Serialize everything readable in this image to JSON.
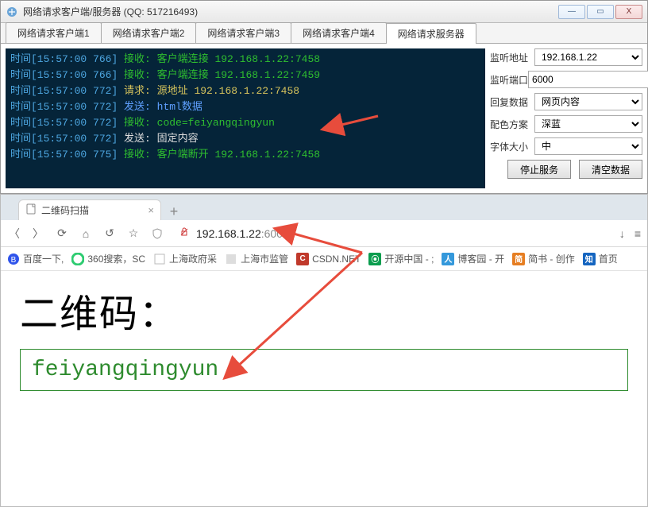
{
  "window": {
    "title": "网络请求客户端/服务器 (QQ: 517216493)",
    "winbtn": {
      "min": "—",
      "max": "▭",
      "close": "X"
    }
  },
  "tabs": [
    "网络请求客户端1",
    "网络请求客户端2",
    "网络请求客户端3",
    "网络请求客户端4",
    "网络请求服务器"
  ],
  "console": [
    {
      "t": "时间[15:57:00 766] ",
      "a": "接收: ",
      "ac": "green",
      "b": "客户端连接 192.168.1.22:7458",
      "bc": "green"
    },
    {
      "t": "时间[15:57:00 766] ",
      "a": "接收: ",
      "ac": "green",
      "b": "客户端连接 192.168.1.22:7459",
      "bc": "green"
    },
    {
      "t": "时间[15:57:00 772] ",
      "a": "请求: ",
      "ac": "yellow",
      "b": "源地址 192.168.1.22:7458",
      "bc": "yellow"
    },
    {
      "t": "时间[15:57:00 772] ",
      "a": "发送: ",
      "ac": "blue",
      "b": "html数据",
      "bc": "blue"
    },
    {
      "t": "时间[15:57:00 772] ",
      "a": "接收: ",
      "ac": "green",
      "b": "code=feiyangqingyun",
      "bc": "green"
    },
    {
      "t": "时间[15:57:00 772] ",
      "a": "发送: ",
      "ac": "white",
      "b": "固定内容",
      "bc": "white"
    },
    {
      "t": "时间[15:57:00 775] ",
      "a": "接收: ",
      "ac": "green",
      "b": "客户端断开 192.168.1.22:7458",
      "bc": "green"
    }
  ],
  "side": {
    "addr_label": "监听地址",
    "addr_value": "192.168.1.22",
    "port_label": "监听端口",
    "port_value": "6000",
    "reply_label": "回复数据",
    "reply_value": "网页内容",
    "theme_label": "配色方案",
    "theme_value": "深蓝",
    "font_label": "字体大小",
    "font_value": "中",
    "stop": "停止服务",
    "clear": "清空数据"
  },
  "browser": {
    "tab_title": "二维码扫描",
    "new": "+",
    "url_host": "192.168.1.22",
    "url_port": ":6000",
    "bookmarks": [
      {
        "icon": "baidu",
        "text": "百度一下,"
      },
      {
        "icon": "q360",
        "text": "360搜索，SC"
      },
      {
        "icon": "blank",
        "text": "上海政府采"
      },
      {
        "icon": "blank2",
        "text": "上海市监管"
      },
      {
        "icon": "csdn",
        "text": "CSDN.NET"
      },
      {
        "icon": "osc",
        "text": "开源中国 - ;"
      },
      {
        "icon": "boke",
        "text": "博客园 - 开"
      },
      {
        "icon": "jian",
        "text": "简书 - 创作"
      },
      {
        "icon": "zhi",
        "text": "首页"
      }
    ],
    "heading": "二维码：",
    "result": "feiyangqingyun"
  }
}
